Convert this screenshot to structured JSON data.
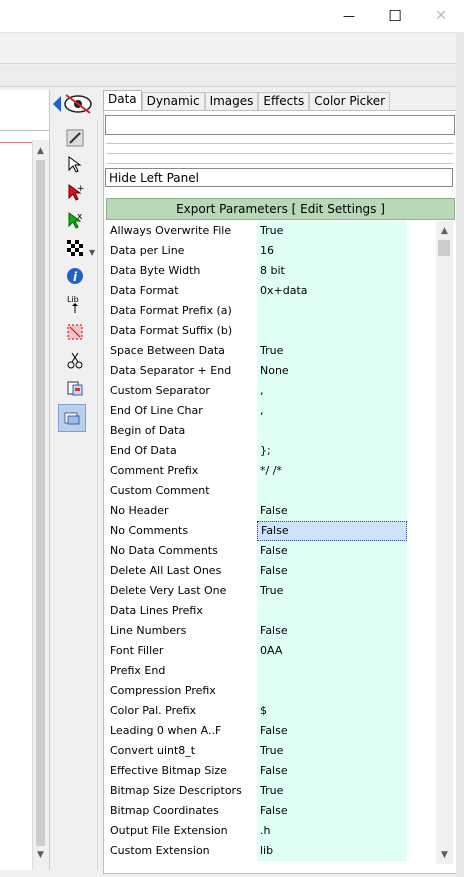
{
  "window": {
    "minimize_glyph": "—",
    "maximize_glyph": "☐",
    "close_glyph": "✕"
  },
  "toolbar": {
    "visibility_icon": "eye-hidden-icon",
    "tools": [
      {
        "name": "eyedropper-icon"
      },
      {
        "name": "select-arrow-icon"
      },
      {
        "name": "red-arrow-add-icon"
      },
      {
        "name": "green-arrow-add-icon"
      },
      {
        "name": "checker-pattern-icon"
      },
      {
        "name": "info-icon"
      },
      {
        "name": "library-icon"
      },
      {
        "name": "crop-selection-icon"
      },
      {
        "name": "scissors-icon"
      },
      {
        "name": "paste-icon"
      },
      {
        "name": "copy-active-icon"
      }
    ]
  },
  "tabs": [
    "Data",
    "Dynamic",
    "Images",
    "Effects",
    "Color Picker"
  ],
  "selected_tab": "Data",
  "panel": {
    "input1_value": "",
    "input2_value": "Hide Left Panel",
    "export_header": "Export Parameters [ Edit Settings ]"
  },
  "params": [
    {
      "name": "Allways Overwrite File",
      "value": "True"
    },
    {
      "name": "Data per Line",
      "value": "16"
    },
    {
      "name": "Data Byte Width",
      "value": "8 bit"
    },
    {
      "name": "Data Format",
      "value": "0x+data"
    },
    {
      "name": "Data Format Prefix (a)",
      "value": ""
    },
    {
      "name": "Data Format Suffix (b)",
      "value": ""
    },
    {
      "name": "Space Between Data",
      "value": "True"
    },
    {
      "name": "Data Separator + End",
      "value": "None"
    },
    {
      "name": "Custom Separator",
      "value": ","
    },
    {
      "name": "End Of Line Char",
      "value": ","
    },
    {
      "name": "Begin of Data",
      "value": ""
    },
    {
      "name": "End Of Data",
      "value": "};"
    },
    {
      "name": "Comment Prefix",
      "value": "*/ /*"
    },
    {
      "name": "Custom Comment",
      "value": ""
    },
    {
      "name": "No Header",
      "value": "False"
    },
    {
      "name": "No Comments",
      "value": "False",
      "selected": true
    },
    {
      "name": "No Data Comments",
      "value": "False"
    },
    {
      "name": "Delete All Last Ones",
      "value": "False"
    },
    {
      "name": "Delete Very Last One",
      "value": "True"
    },
    {
      "name": "Data Lines Prefix",
      "value": ""
    },
    {
      "name": "Line Numbers",
      "value": "False"
    },
    {
      "name": "Font Filler",
      "value": "0AA"
    },
    {
      "name": "Prefix End",
      "value": ""
    },
    {
      "name": "Compression Prefix",
      "value": ""
    },
    {
      "name": "Color Pal. Prefix",
      "value": "$"
    },
    {
      "name": "Leading 0 when A..F",
      "value": "False"
    },
    {
      "name": "Convert uint8_t",
      "value": "True"
    },
    {
      "name": "Effective Bitmap Size",
      "value": "False"
    },
    {
      "name": "Bitmap Size Descriptors",
      "value": "True"
    },
    {
      "name": "Bitmap Coordinates",
      "value": "False"
    },
    {
      "name": "Output File Extension",
      "value": ".h"
    },
    {
      "name": "Custom Extension",
      "value": "lib"
    }
  ]
}
